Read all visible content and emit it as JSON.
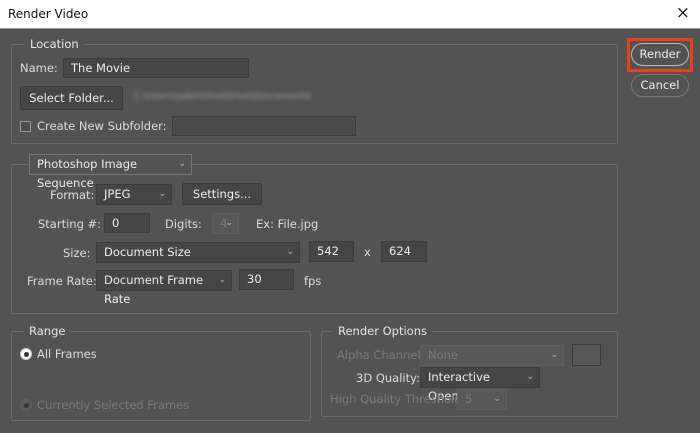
{
  "window": {
    "title": "Render Video",
    "close_icon": "×"
  },
  "actions": {
    "render": "Render",
    "cancel": "Cancel",
    "highlight_color": "#e8401c"
  },
  "location": {
    "legend": "Location",
    "name_label": "Name:",
    "name_value": "The Movie",
    "select_folder": "Select Folder...",
    "folder_path": "C:\\Users\\jabri\\OneDrive\\Documents",
    "subfolder_label": "Create New Subfolder:",
    "subfolder_value": ""
  },
  "export": {
    "mode": "Photoshop Image Sequence",
    "format_label": "Format:",
    "format_value": "JPEG",
    "settings": "Settings...",
    "starting_label": "Starting #:",
    "starting_value": "0",
    "digits_label": "Digits:",
    "digits_value": "4",
    "example": "Ex: File.jpg",
    "size_label": "Size:",
    "size_value": "Document Size",
    "width": "542",
    "x": "x",
    "height": "624",
    "framerate_label": "Frame Rate:",
    "framerate_value": "Document Frame Rate",
    "fps_value": "30",
    "fps": "fps"
  },
  "range": {
    "legend": "Range",
    "all_frames": "All Frames",
    "selected_frames": "Currently Selected Frames"
  },
  "render_options": {
    "legend": "Render Options",
    "alpha_label": "Alpha Channel:",
    "alpha_value": "None",
    "quality_label": "3D Quality:",
    "quality_value": "Interactive OpenGL",
    "threshold_label": "High Quality Threshold:",
    "threshold_value": "5"
  },
  "chevron": "⌄"
}
